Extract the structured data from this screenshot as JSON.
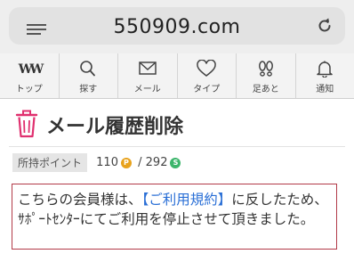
{
  "browser": {
    "url": "550909.com",
    "menu_icon": "menu-lines-icon",
    "reload_icon": "reload-icon"
  },
  "nav": {
    "items": [
      {
        "label": "トップ",
        "icon": "ww-logo-icon",
        "glyph": "WW"
      },
      {
        "label": "探す",
        "icon": "search-icon"
      },
      {
        "label": "メール",
        "icon": "mail-icon"
      },
      {
        "label": "タイプ",
        "icon": "heart-icon"
      },
      {
        "label": "足あと",
        "icon": "footprints-icon"
      },
      {
        "label": "通知",
        "icon": "bell-icon"
      }
    ]
  },
  "page": {
    "title": "メール履歴削除",
    "title_icon": "trash-icon",
    "accent_color": "#e0306f"
  },
  "points": {
    "label": "所持ポイント",
    "p_value": "110",
    "p_badge": "P",
    "separator": "/",
    "s_value": "292",
    "s_badge": "S"
  },
  "notice": {
    "text_before": "こちらの会員様は、",
    "link_text": "【ご利用規約】",
    "text_after": "に反したため、ｻﾎﾟｰﾄｾﾝﾀｰにてご利用を停止させて頂きました。",
    "border_color": "#b23a48",
    "link_color": "#2a6fd6"
  }
}
